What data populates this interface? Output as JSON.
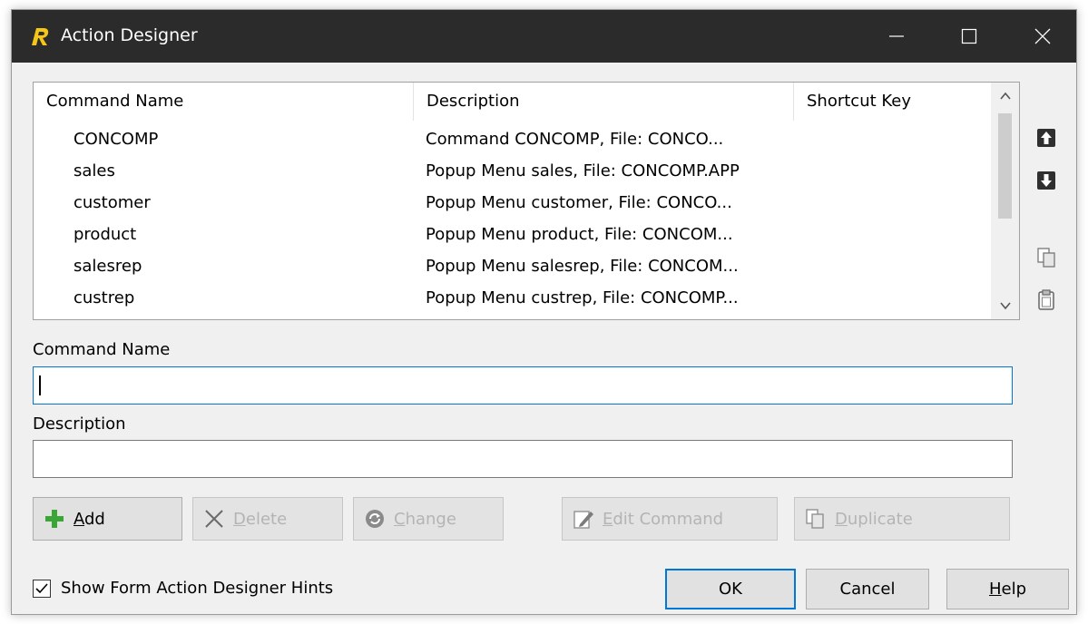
{
  "window": {
    "title": "Action Designer"
  },
  "list": {
    "columns": [
      "Command Name",
      "Description",
      "Shortcut Key"
    ],
    "rows": [
      {
        "name": "CONCOMP",
        "description": "Command CONCOMP, File: CONCO..."
      },
      {
        "name": "sales",
        "description": "Popup Menu sales, File: CONCOMP.APP"
      },
      {
        "name": "customer",
        "description": "Popup Menu customer, File: CONCO..."
      },
      {
        "name": "product",
        "description": "Popup Menu product, File: CONCOM..."
      },
      {
        "name": "salesrep",
        "description": "Popup Menu salesrep, File: CONCOM..."
      },
      {
        "name": "custrep",
        "description": "Popup Menu custrep, File: CONCOMP..."
      }
    ]
  },
  "form": {
    "command_name_label": "Command Name",
    "command_name_value": "",
    "description_label": "Description",
    "description_value": ""
  },
  "actions": {
    "add": {
      "pre": "",
      "u": "A",
      "post": "dd"
    },
    "delete": {
      "pre": "",
      "u": "D",
      "post": "elete"
    },
    "change": {
      "pre": "",
      "u": "C",
      "post": "hange"
    },
    "edit_command": {
      "pre": "",
      "u": "E",
      "post": "dit Command"
    },
    "duplicate": {
      "pre": "",
      "u": "D",
      "post": "uplicate"
    }
  },
  "footer": {
    "hints_label": "Show Form Action Designer Hints",
    "hints_checked": true,
    "ok": "OK",
    "cancel": "Cancel",
    "help": {
      "pre": "",
      "u": "H",
      "post": "elp"
    }
  },
  "icons": {
    "title_icon": "r-logo-icon",
    "move_up": "arrow-up-icon",
    "move_down": "arrow-down-icon",
    "copy": "copy-icon",
    "paste": "paste-icon",
    "add": "plus-icon",
    "delete": "x-icon",
    "change": "change-icon",
    "edit": "pencil-icon",
    "duplicate": "duplicate-icon"
  },
  "colors": {
    "titlebar": "#2b2b2b",
    "focus": "#0078d7",
    "add_green": "#3aa635"
  }
}
